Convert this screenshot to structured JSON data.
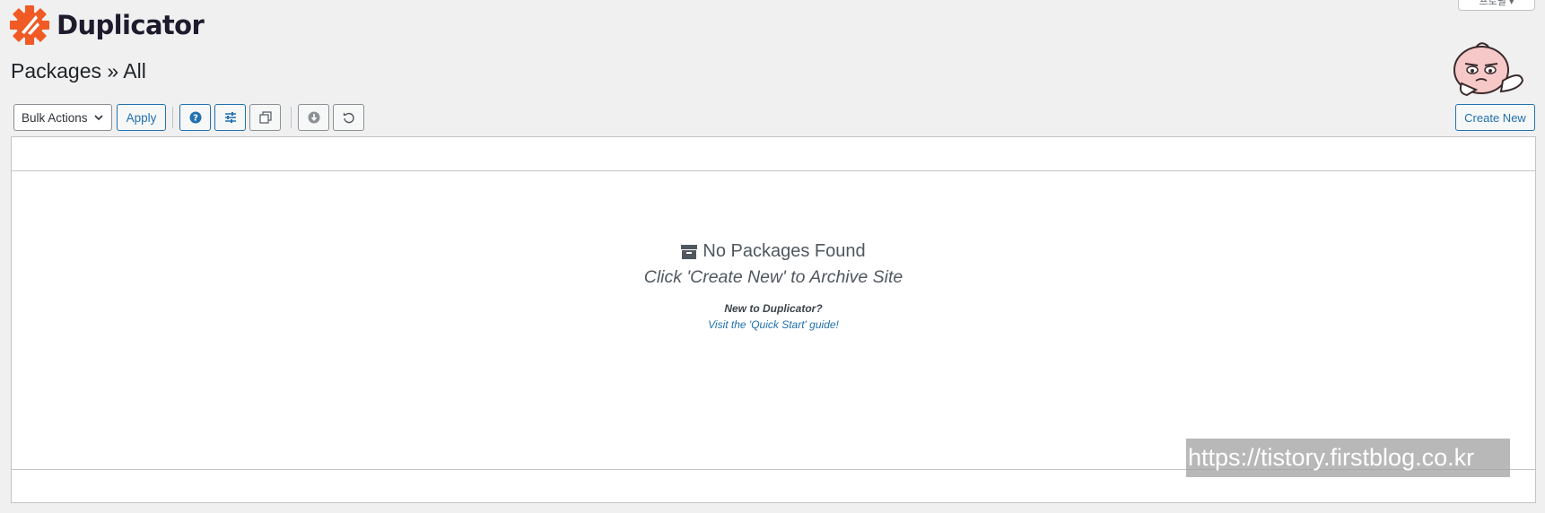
{
  "brand": {
    "name": "Duplicator",
    "accent": "#f15a24"
  },
  "top_tab": {
    "label": "프로필 ▾"
  },
  "page": {
    "title": "Packages » All"
  },
  "toolbar": {
    "bulk_actions": "Bulk Actions",
    "apply": "Apply",
    "icons": [
      "help-icon",
      "settings-sliders-icon",
      "copy-icon",
      "download-icon",
      "undo-icon"
    ],
    "create_new": "Create New"
  },
  "empty_state": {
    "title": "No Packages Found",
    "subtitle": "Click 'Create New' to Archive Site",
    "new_to": "New to Duplicator?",
    "guide_link": "Visit the 'Quick Start' guide!"
  },
  "watermark": {
    "text": "https://tistory.firstblog.co.kr"
  },
  "colors": {
    "link_blue": "#2271b1",
    "border": "#c3c4c7",
    "background": "#f0f0f1"
  }
}
